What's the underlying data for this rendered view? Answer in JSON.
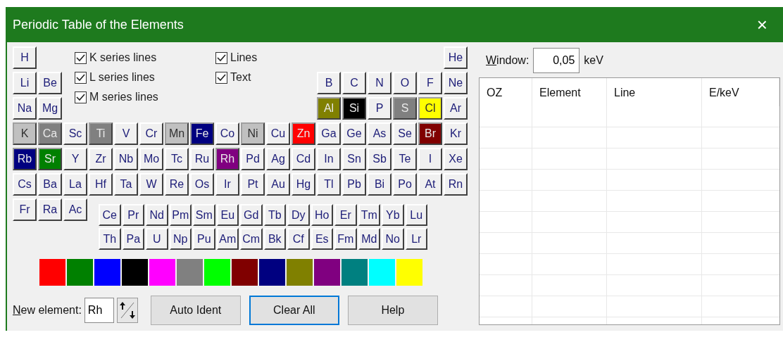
{
  "window": {
    "title": "Periodic Table of the Elements",
    "close": "×"
  },
  "options": [
    {
      "label": "K series lines",
      "checked": true
    },
    {
      "label": "L series lines",
      "checked": true
    },
    {
      "label": "M series lines",
      "checked": true
    },
    {
      "label": "Lines",
      "checked": true
    },
    {
      "label": "Text",
      "checked": true
    }
  ],
  "elements": [
    [
      {
        "symbol": "H"
      },
      {
        "symbol": "He"
      }
    ],
    [
      {
        "symbol": "Li"
      },
      {
        "symbol": "Be"
      },
      {
        "symbol": "B"
      },
      {
        "symbol": "C"
      },
      {
        "symbol": "N"
      },
      {
        "symbol": "O"
      },
      {
        "symbol": "F"
      },
      {
        "symbol": "Ne"
      }
    ],
    [
      {
        "symbol": "Na"
      },
      {
        "symbol": "Mg"
      },
      {
        "symbol": "Al",
        "color": "#808000"
      },
      {
        "symbol": "Si",
        "color": "#000000"
      },
      {
        "symbol": "P"
      },
      {
        "symbol": "S",
        "color": "#808080"
      },
      {
        "symbol": "Cl",
        "color": "#ffff00"
      },
      {
        "symbol": "Ar"
      }
    ],
    [
      {
        "symbol": "K",
        "color": "#c0c0c0"
      },
      {
        "symbol": "Ca",
        "color": "#808080"
      },
      {
        "symbol": "Sc"
      },
      {
        "symbol": "Ti",
        "color": "#808080"
      },
      {
        "symbol": "V"
      },
      {
        "symbol": "Cr"
      },
      {
        "symbol": "Mn",
        "color": "#c0c0c0"
      },
      {
        "symbol": "Fe",
        "color": "#000080"
      },
      {
        "symbol": "Co"
      },
      {
        "symbol": "Ni",
        "color": "#c0c0c0"
      },
      {
        "symbol": "Cu"
      },
      {
        "symbol": "Zn",
        "color": "#ff0000"
      },
      {
        "symbol": "Ga"
      },
      {
        "symbol": "Ge"
      },
      {
        "symbol": "As"
      },
      {
        "symbol": "Se"
      },
      {
        "symbol": "Br",
        "color": "#800000"
      },
      {
        "symbol": "Kr"
      }
    ],
    [
      {
        "symbol": "Rb",
        "color": "#000080"
      },
      {
        "symbol": "Sr",
        "color": "#008000"
      },
      {
        "symbol": "Y"
      },
      {
        "symbol": "Zr"
      },
      {
        "symbol": "Nb"
      },
      {
        "symbol": "Mo"
      },
      {
        "symbol": "Tc"
      },
      {
        "symbol": "Ru"
      },
      {
        "symbol": "Rh",
        "color": "#800080"
      },
      {
        "symbol": "Pd"
      },
      {
        "symbol": "Ag"
      },
      {
        "symbol": "Cd"
      },
      {
        "symbol": "In"
      },
      {
        "symbol": "Sn"
      },
      {
        "symbol": "Sb"
      },
      {
        "symbol": "Te"
      },
      {
        "symbol": "I"
      },
      {
        "symbol": "Xe"
      }
    ],
    [
      {
        "symbol": "Cs"
      },
      {
        "symbol": "Ba"
      },
      {
        "symbol": "La"
      },
      {
        "symbol": "Hf"
      },
      {
        "symbol": "Ta"
      },
      {
        "symbol": "W"
      },
      {
        "symbol": "Re"
      },
      {
        "symbol": "Os"
      },
      {
        "symbol": "Ir"
      },
      {
        "symbol": "Pt"
      },
      {
        "symbol": "Au"
      },
      {
        "symbol": "Hg"
      },
      {
        "symbol": "Tl"
      },
      {
        "symbol": "Pb"
      },
      {
        "symbol": "Bi"
      },
      {
        "symbol": "Po"
      },
      {
        "symbol": "At"
      },
      {
        "symbol": "Rn"
      }
    ],
    [
      {
        "symbol": "Fr"
      },
      {
        "symbol": "Ra"
      },
      {
        "symbol": "Ac"
      }
    ]
  ],
  "lanthanides": [
    {
      "symbol": "Ce"
    },
    {
      "symbol": "Pr"
    },
    {
      "symbol": "Nd"
    },
    {
      "symbol": "Pm"
    },
    {
      "symbol": "Sm"
    },
    {
      "symbol": "Eu"
    },
    {
      "symbol": "Gd"
    },
    {
      "symbol": "Tb"
    },
    {
      "symbol": "Dy"
    },
    {
      "symbol": "Ho"
    },
    {
      "symbol": "Er"
    },
    {
      "symbol": "Tm"
    },
    {
      "symbol": "Yb"
    },
    {
      "symbol": "Lu"
    }
  ],
  "actinides": [
    {
      "symbol": "Th"
    },
    {
      "symbol": "Pa"
    },
    {
      "symbol": "U"
    },
    {
      "symbol": "Np"
    },
    {
      "symbol": "Pu"
    },
    {
      "symbol": "Am"
    },
    {
      "symbol": "Cm"
    },
    {
      "symbol": "Bk"
    },
    {
      "symbol": "Cf"
    },
    {
      "symbol": "Es"
    },
    {
      "symbol": "Fm"
    },
    {
      "symbol": "Md"
    },
    {
      "symbol": "No"
    },
    {
      "symbol": "Lr"
    }
  ],
  "palette": [
    {
      "color": "#ff0000"
    },
    {
      "color": "#008000"
    },
    {
      "color": "#0000ff"
    },
    {
      "color": "#000000"
    },
    {
      "color": "#ff00ff"
    },
    {
      "color": "#808080"
    },
    {
      "color": "#00ff00"
    },
    {
      "color": "#800000"
    },
    {
      "color": "#000080"
    },
    {
      "color": "#808000"
    },
    {
      "color": "#800080"
    },
    {
      "color": "#008080"
    },
    {
      "color": "#00ffff"
    },
    {
      "color": "#ffff00"
    }
  ],
  "new_element": {
    "label": "New element:",
    "value": "Rh"
  },
  "buttons": [
    {
      "label": "Auto Ident",
      "focused": false
    },
    {
      "label": "Clear All",
      "focused": true
    },
    {
      "label": "Help",
      "focused": false
    }
  ],
  "window_field": {
    "label": "Window:",
    "value": "0,05",
    "unit": "keV"
  },
  "table": {
    "columns": [
      "OZ",
      "Element",
      "Line",
      "E/keV"
    ]
  }
}
